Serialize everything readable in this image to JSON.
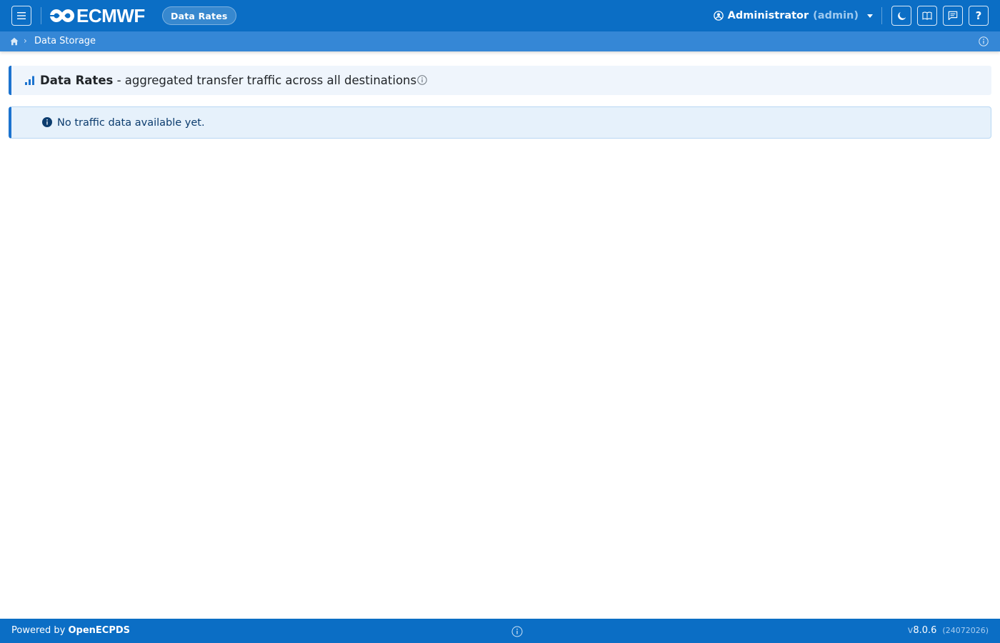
{
  "header": {
    "logo_text": "ECMWF",
    "page_pill": "Data Rates",
    "user": {
      "name": "Administrator",
      "role": "(admin)"
    },
    "icons": [
      "moon-icon",
      "book-icon",
      "message-icon",
      "help-icon"
    ],
    "help_label": "?"
  },
  "breadcrumb": {
    "items": [
      "Data Storage"
    ]
  },
  "title": {
    "main": "Data Rates",
    "subtitle": " - aggregated transfer traffic across all destinations"
  },
  "alert": {
    "message": "No traffic data available yet."
  },
  "footer": {
    "powered_prefix": "Powered by",
    "powered_brand": "OpenECPDS",
    "version_prefix": "v",
    "version": "8.0.6",
    "build": "(24072026)"
  },
  "colors": {
    "navbar": "#0b6ec5",
    "breadcrumb_bar": "#3587d6",
    "accent": "#1c73cf",
    "alert_bg": "#e6f1fb",
    "title_bg": "#eff5fc"
  }
}
